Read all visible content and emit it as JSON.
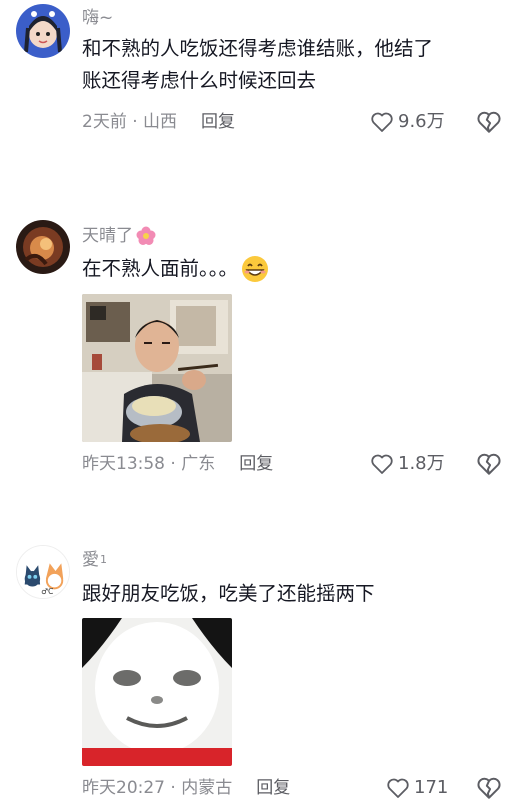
{
  "comments": [
    {
      "user": "嗨~",
      "text_line1": "和不熟的人吃饭还得考虑谁结账，他结了",
      "text_line2": "账还得考虑什么时候还回去",
      "time_location": "2天前 · 山西",
      "reply_label": "回复",
      "likes": "9.6万"
    },
    {
      "user": "天晴了",
      "text": "在不熟人面前。。。",
      "time_location": "昨天13:58 · 广东",
      "reply_label": "回复",
      "likes": "1.8万"
    },
    {
      "user": "愛",
      "user_badge": "1",
      "text": "跟好朋友吃饭，吃美了还能摇两下",
      "time_location": "昨天20:27 · 内蒙古",
      "reply_label": "回复",
      "likes": "171"
    }
  ]
}
